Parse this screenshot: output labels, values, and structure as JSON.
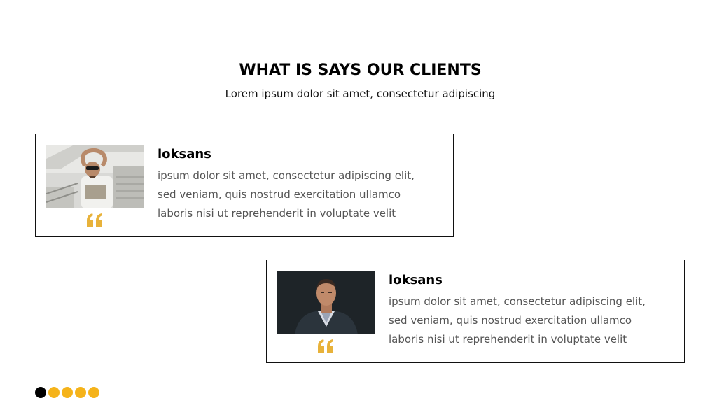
{
  "header": {
    "title": "WHAT IS SAYS OUR CLIENTS",
    "subtitle": "Lorem ipsum dolor sit amet, consectetur adipiscing"
  },
  "testimonials": [
    {
      "name": "loksans",
      "lines": [
        "ipsum dolor sit amet, consectetur adipiscing elit,",
        "sed veniam, quis nostrud exercitation ullamco",
        "laboris nisi ut reprehenderit in voluptate velit"
      ],
      "icon": "quote-icon"
    },
    {
      "name": "loksans",
      "lines": [
        "ipsum dolor sit amet, consectetur adipiscing elit,",
        "sed veniam, quis nostrud exercitation ullamco",
        "laboris nisi ut reprehenderit in voluptate velit"
      ],
      "icon": "quote-icon"
    }
  ],
  "pagination": {
    "count": 5,
    "active_index": 0
  },
  "colors": {
    "accent": "#f5b31a",
    "active_dot": "#000000",
    "quote": "#e8b23a"
  }
}
